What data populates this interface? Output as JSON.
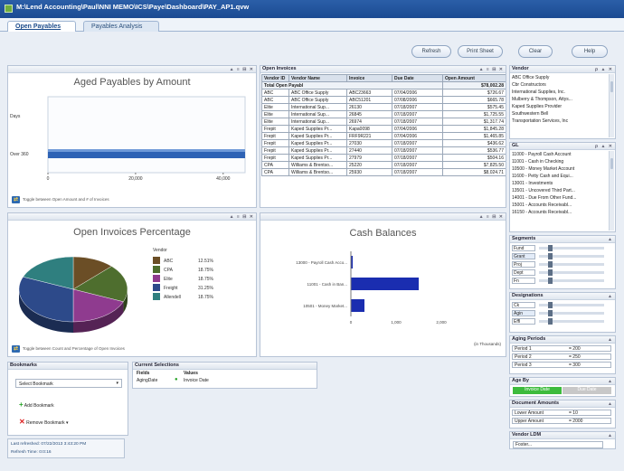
{
  "window": {
    "title": "M:\\Lend Accounting\\Paul\\NNI MEMO\\ICS\\Paye\\Dashboard\\PAY_AP1.qvw"
  },
  "tabs": [
    {
      "label": "Open Payables",
      "active": true
    },
    {
      "label": "Payables Analysis",
      "active": false
    }
  ],
  "toolbar": {
    "refresh": "Refresh",
    "print_sheet": "Print Sheet",
    "clear": "Clear",
    "help": "Help"
  },
  "aged_payables": {
    "title": "Aged Payables by Amount",
    "toggle_note": "Toggle between Open Amount and # of Invoices"
  },
  "chart_data": [
    {
      "type": "bar",
      "orientation": "horizontal",
      "title": "Aged Payables by Amount",
      "categories": [
        "Days",
        "Over 360"
      ],
      "values": [
        0,
        47000
      ],
      "ticks": [
        "0",
        "20,000",
        "40,000"
      ],
      "xlim": [
        0,
        45000
      ]
    },
    {
      "type": "pie",
      "title": "Open Invoices Percentage",
      "legend_title": "Vendor",
      "categories": [
        "ABC",
        "CPA",
        "Elite",
        "Freight",
        "Allendell"
      ],
      "values": [
        12.5,
        18.75,
        18.75,
        31.25,
        18.75
      ],
      "labels": [
        "12.51%",
        "18.75%",
        "18.75%",
        "31.25%",
        "18.75%"
      ],
      "colors": [
        "#6b4e26",
        "#4e6e2e",
        "#8f3b8f",
        "#2d4a8a",
        "#2f7f7f"
      ]
    },
    {
      "type": "bar",
      "orientation": "horizontal",
      "title": "Cash Balances",
      "categories": [
        "13000 - Payroll Cash Acco...",
        "11001 - Cash in Ban...",
        "10501 - Money Market..."
      ],
      "values": [
        40,
        1500,
        300
      ],
      "ticks": [
        "0",
        "1,000",
        "2,000"
      ],
      "xlim": [
        0,
        2000
      ],
      "unit_note": "(in Thousands)"
    }
  ],
  "open_invoices": {
    "title": "Open Invoices",
    "columns": [
      "Vendor ID",
      "Vendor Name",
      "Invoice",
      "Due Date",
      "Open Amount"
    ],
    "total": {
      "label": "Total Open Payabl",
      "amount": "$78,002.28"
    },
    "rows": [
      [
        "ABC",
        "ABC Office Supply",
        "ABC23663",
        "07/04/2006",
        "$726.67"
      ],
      [
        "ABC",
        "ABC Office Supply",
        "ABC51201",
        "07/08/2006",
        "$665.78"
      ],
      [
        "Elite",
        "International Sup...",
        "26130",
        "07/18/2007",
        "$575.45"
      ],
      [
        "Elite",
        "International Sup...",
        "26845",
        "07/18/2007",
        "$1,725.55"
      ],
      [
        "Elite",
        "International Sup...",
        "26974",
        "07/18/2007",
        "$1,317.74"
      ],
      [
        "Frepit",
        "Kaped Supplies Pr...",
        "Kapa0098",
        "07/04/2006",
        "$1,845.28"
      ],
      [
        "Frepit",
        "Kaped Supplies Pr...",
        "FRF9R221",
        "07/04/2006",
        "$1,465.85"
      ],
      [
        "Frepit",
        "Kaped Supplies Pr...",
        "27030",
        "07/18/2007",
        "$436.62"
      ],
      [
        "Frepit",
        "Kaped Supplies Pr...",
        "27440",
        "07/18/2007",
        "$536.77"
      ],
      [
        "Frepit",
        "Kaped Supplies Pr...",
        "27979",
        "07/18/2007",
        "$504.16"
      ],
      [
        "CPA",
        "Williams & Brentso...",
        "25220",
        "07/18/2007",
        "$7,825.50"
      ],
      [
        "CPA",
        "Williams & Brentso...",
        "25930",
        "07/18/2007",
        "$8,024.71"
      ]
    ]
  },
  "vendor_list": {
    "title": "Vendor",
    "items": [
      "ABC Office Supply",
      "Cbr Constructors",
      "International Supplies, Inc.",
      "Mulberry & Thompson, Attys...",
      "Kaped Supplies Provider",
      "Southwestern Bell",
      "Transportation Services, Inc"
    ]
  },
  "gl_list": {
    "title": "GL",
    "items": [
      "11000 - Payroll Cash Account",
      "11001 - Cash in Checking",
      "10500 - Money Market Account",
      "11600 - Petty Cash and Equi...",
      "13001 - Investments",
      "13501 - Uncovered Third Part...",
      "14001 - Due From Other Fund...",
      "15001 - Accounts Receivabl...",
      "16150 - Accounts Receivabl..."
    ]
  },
  "segments": {
    "title": "Segments",
    "items": [
      "Fund",
      "Grant",
      "Proj",
      "Dept",
      "Fn"
    ]
  },
  "designations": {
    "title": "Designations",
    "items": [
      "Ck",
      "Agin",
      "Effl"
    ]
  },
  "aging_periods": {
    "title": "Aging Periods",
    "rows": [
      {
        "label": "Period 1",
        "value": "= 200"
      },
      {
        "label": "Period 2",
        "value": "= 250"
      },
      {
        "label": "Period 3",
        "value": "= 300"
      }
    ]
  },
  "age_by": {
    "title": "Age By",
    "options": [
      "Invoice Date",
      "Due Date"
    ],
    "selected": "Invoice Date"
  },
  "document_amounts": {
    "title": "Document Amounts",
    "rows": [
      {
        "label": "Lower Amount",
        "value": "= 10"
      },
      {
        "label": "Upper Amount",
        "value": "= 2000"
      }
    ]
  },
  "vendor_search": {
    "title": "Vendor LDM",
    "value": "Foster..."
  },
  "bookmarks": {
    "title": "Bookmarks",
    "select_label": "Select Bookmark",
    "add_label": "Add Bookmark",
    "remove_label": "Remove Bookmark"
  },
  "current_selections": {
    "title": "Current Selections",
    "col_fields": "Fields",
    "col_values": "Values",
    "rows": [
      {
        "field": "AgingDate",
        "value": "Invoice Date"
      }
    ]
  },
  "status": {
    "line1": "Last refreshed: 07/22/2013 3:43:20 PM",
    "line2": "Refresh Time: 0:0:16"
  },
  "colors": {
    "bar_blue": "#2e63b5",
    "cash_bar": "#1a2db0",
    "selected_green": "#3dbb3d",
    "title_blue": "#1b4a92"
  }
}
